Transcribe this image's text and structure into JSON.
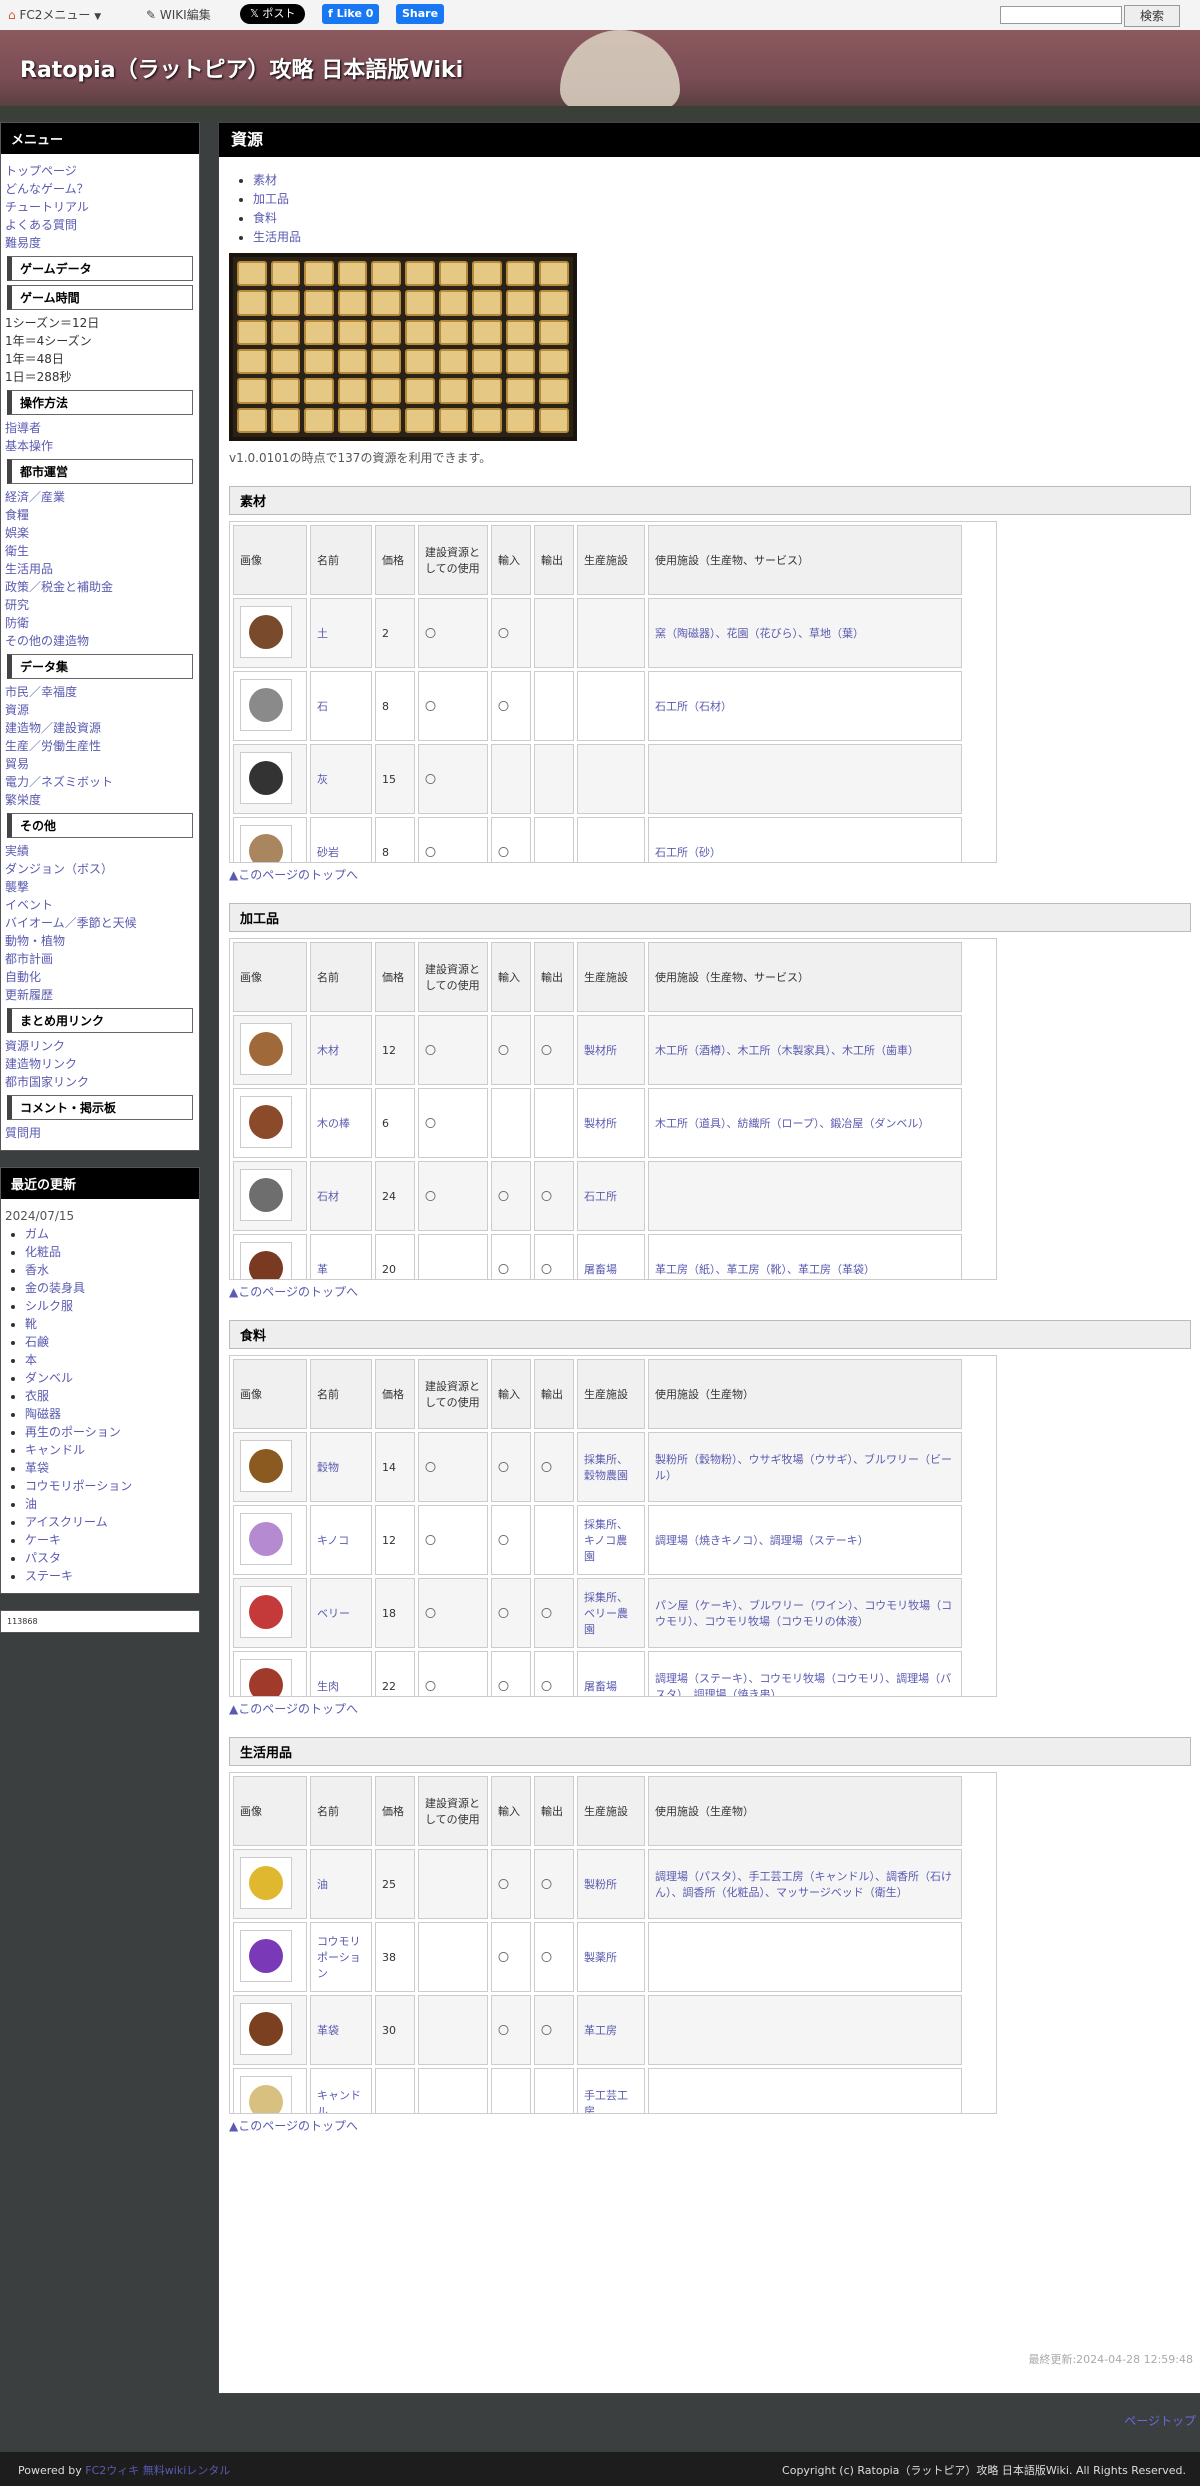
{
  "topbar": {
    "fc2_menu": "FC2メニュー",
    "wiki_edit": "WIKI編集",
    "x_post": "ポスト",
    "fb_like": "Like 0",
    "fb_share": "Share",
    "search_button": "検索",
    "search_placeholder": ""
  },
  "header": {
    "site_title": "Ratopia（ラットピア）攻略 日本語版Wiki"
  },
  "sidebar": {
    "menu_title": "メニュー",
    "top_links": [
      "トップページ",
      "どんなゲーム？",
      "チュートリアル",
      "よくある質問",
      "難易度"
    ],
    "h_game_data": "ゲームデータ",
    "h_game_time": "ゲーム時間",
    "time_lines": [
      "1シーズン＝12日",
      "1年＝4シーズン",
      "1年＝48日",
      "1日＝288秒"
    ],
    "h_controls": "操作方法",
    "control_links": [
      "指導者",
      "基本操作"
    ],
    "h_city": "都市運営",
    "city_links": [
      "経済／産業",
      "食糧",
      "娯楽",
      "衛生",
      "生活用品",
      "政策／税金と補助金",
      "研究",
      "防衛",
      "その他の建造物"
    ],
    "h_data": "データ集",
    "data_links": [
      "市民／幸福度",
      "資源",
      "建造物／建設資源",
      "生産／労働生産性",
      "貿易",
      "電力／ネズミボット",
      "繁栄度"
    ],
    "h_other": "その他",
    "other_links": [
      "実績",
      "ダンジョン（ボス）",
      "襲撃",
      "イベント",
      "バイオーム／季節と天候",
      "動物・植物",
      "都市計画",
      "自動化",
      "更新履歴"
    ],
    "h_links": "まとめ用リンク",
    "link_links": [
      "資源リンク",
      "建造物リンク",
      "都市国家リンク"
    ],
    "h_comments": "コメント・掲示板",
    "comment_links": [
      "質問用"
    ],
    "recent_title": "最近の更新",
    "recent_date": "2024/07/15",
    "recent_items": [
      "ガム",
      "化粧品",
      "香水",
      "金の装身具",
      "シルク服",
      "靴",
      "石鹸",
      "本",
      "ダンベル",
      "衣服",
      "陶磁器",
      "再生のポーション",
      "キャンドル",
      "革袋",
      "コウモリポーション",
      "油",
      "アイスクリーム",
      "ケーキ",
      "パスタ",
      "ステーキ"
    ],
    "counter": "113868"
  },
  "main": {
    "page_title": "資源",
    "toc": [
      "素材",
      "加工品",
      "食料",
      "生活用品"
    ],
    "version_note": "v1.0.0101の時点で137の資源を利用できます。",
    "to_top": "▲このページのトップへ",
    "last_updated": "最終更新:2024-04-28 12:59:48"
  },
  "sections": [
    {
      "title": "素材",
      "headers": [
        "画像",
        "名前",
        "価格",
        "建設資源としての使用",
        "輸入",
        "輸出",
        "生産施設",
        "使用施設（生産物、サービス）"
      ],
      "rows": [
        {
          "icon": "dirt-icon",
          "color": "#7a4a2c",
          "name": "土",
          "price": "2",
          "build": "〇",
          "import": "〇",
          "export": "",
          "facility": "",
          "use": "窯（陶磁器）、花園（花びら）、草地（葉）"
        },
        {
          "icon": "stone-icon",
          "color": "#8a8a8a",
          "name": "石",
          "price": "8",
          "build": "〇",
          "import": "〇",
          "export": "",
          "facility": "",
          "use": "石工所（石材）"
        },
        {
          "icon": "ash-icon",
          "color": "#333333",
          "name": "灰",
          "price": "15",
          "build": "〇",
          "import": "",
          "export": "",
          "facility": "",
          "use": ""
        },
        {
          "icon": "sandstone-icon",
          "color": "#a98560",
          "name": "砂岩",
          "price": "8",
          "build": "〇",
          "import": "〇",
          "export": "",
          "facility": "",
          "use": "石工所（砂）"
        }
      ]
    },
    {
      "title": "加工品",
      "headers": [
        "画像",
        "名前",
        "価格",
        "建設資源としての使用",
        "輸入",
        "輸出",
        "生産施設",
        "使用施設（生産物、サービス）"
      ],
      "rows": [
        {
          "icon": "lumber-icon",
          "color": "#a0693a",
          "name": "木材",
          "price": "12",
          "build": "〇",
          "import": "〇",
          "export": "〇",
          "facility": "製材所",
          "use": "木工所（酒樽）、木工所（木製家具）、木工所（歯車）"
        },
        {
          "icon": "stick-icon",
          "color": "#8b4a2a",
          "name": "木の棒",
          "price": "6",
          "build": "〇",
          "import": "",
          "export": "",
          "facility": "製材所",
          "use": "木工所（道具）、紡織所（ロープ）、鍛冶屋（ダンベル）"
        },
        {
          "icon": "stone-block-icon",
          "color": "#6e6e6e",
          "name": "石材",
          "price": "24",
          "build": "〇",
          "import": "〇",
          "export": "〇",
          "facility": "石工所",
          "use": ""
        },
        {
          "icon": "leather-icon",
          "color": "#7a3a22",
          "name": "革",
          "price": "20",
          "build": "",
          "import": "〇",
          "export": "〇",
          "facility": "屠畜場",
          "use": "革工房（紙）、革工房（靴）、革工房（革袋）"
        }
      ]
    },
    {
      "title": "食料",
      "headers": [
        "画像",
        "名前",
        "価格",
        "建設資源としての使用",
        "輸入",
        "輸出",
        "生産施設",
        "使用施設（生産物）"
      ],
      "rows": [
        {
          "icon": "grain-icon",
          "color": "#8a5a20",
          "name": "穀物",
          "price": "14",
          "build": "〇",
          "import": "〇",
          "export": "〇",
          "facility": "採集所、穀物農園",
          "use": "製粉所（穀物粉）、ウサギ牧場（ウサギ）、ブルワリー（ビール）"
        },
        {
          "icon": "mushroom-icon",
          "color": "#b68ad0",
          "name": "キノコ",
          "price": "12",
          "build": "〇",
          "import": "〇",
          "export": "",
          "facility": "採集所、キノコ農園",
          "use": "調理場（焼きキノコ）、調理場（ステーキ）"
        },
        {
          "icon": "berry-icon",
          "color": "#c43a3a",
          "name": "ベリー",
          "price": "18",
          "build": "〇",
          "import": "〇",
          "export": "〇",
          "facility": "採集所、ベリー農園",
          "use": "パン屋（ケーキ）、ブルワリー（ワイン）、コウモリ牧場（コウモリ）、コウモリ牧場（コウモリの体液）"
        },
        {
          "icon": "meat-icon",
          "color": "#a03a2a",
          "name": "生肉",
          "price": "22",
          "build": "〇",
          "import": "〇",
          "export": "〇",
          "facility": "屠畜場",
          "use": "調理場（ステーキ）、コウモリ牧場（コウモリ）、調理場（パスタ）、調理場（焼き串）"
        }
      ]
    },
    {
      "title": "生活用品",
      "headers": [
        "画像",
        "名前",
        "価格",
        "建設資源としての使用",
        "輸入",
        "輸出",
        "生産施設",
        "使用施設（生産物）"
      ],
      "rows": [
        {
          "icon": "oil-icon",
          "color": "#e0b830",
          "name": "油",
          "price": "25",
          "build": "",
          "import": "〇",
          "export": "〇",
          "facility": "製粉所",
          "use": "調理場（パスタ）、手工芸工房（キャンドル）、調香所（石けん）、調香所（化粧品）、マッサージベッド（衛生）"
        },
        {
          "icon": "bat-potion-icon",
          "color": "#7a3ab8",
          "name": "コウモリポーション",
          "price": "38",
          "build": "",
          "import": "〇",
          "export": "〇",
          "facility": "製薬所",
          "use": ""
        },
        {
          "icon": "leather-bag-icon",
          "color": "#7a4020",
          "name": "革袋",
          "price": "30",
          "build": "",
          "import": "〇",
          "export": "〇",
          "facility": "革工房",
          "use": ""
        },
        {
          "icon": "candle-icon",
          "color": "#d8c080",
          "name": "キャンドル",
          "price": "",
          "build": "",
          "import": "",
          "export": "",
          "facility": "手工芸工房",
          "use": ""
        }
      ]
    }
  ],
  "footer": {
    "powered_prefix": "Powered by",
    "powered_link": "FC2ウィキ 無料wikiレンタル",
    "page_top": "ページトップ",
    "copyright": "Copyright (c) Ratopia（ラットピア）攻略 日本語版Wiki. All Rights Reserved."
  }
}
